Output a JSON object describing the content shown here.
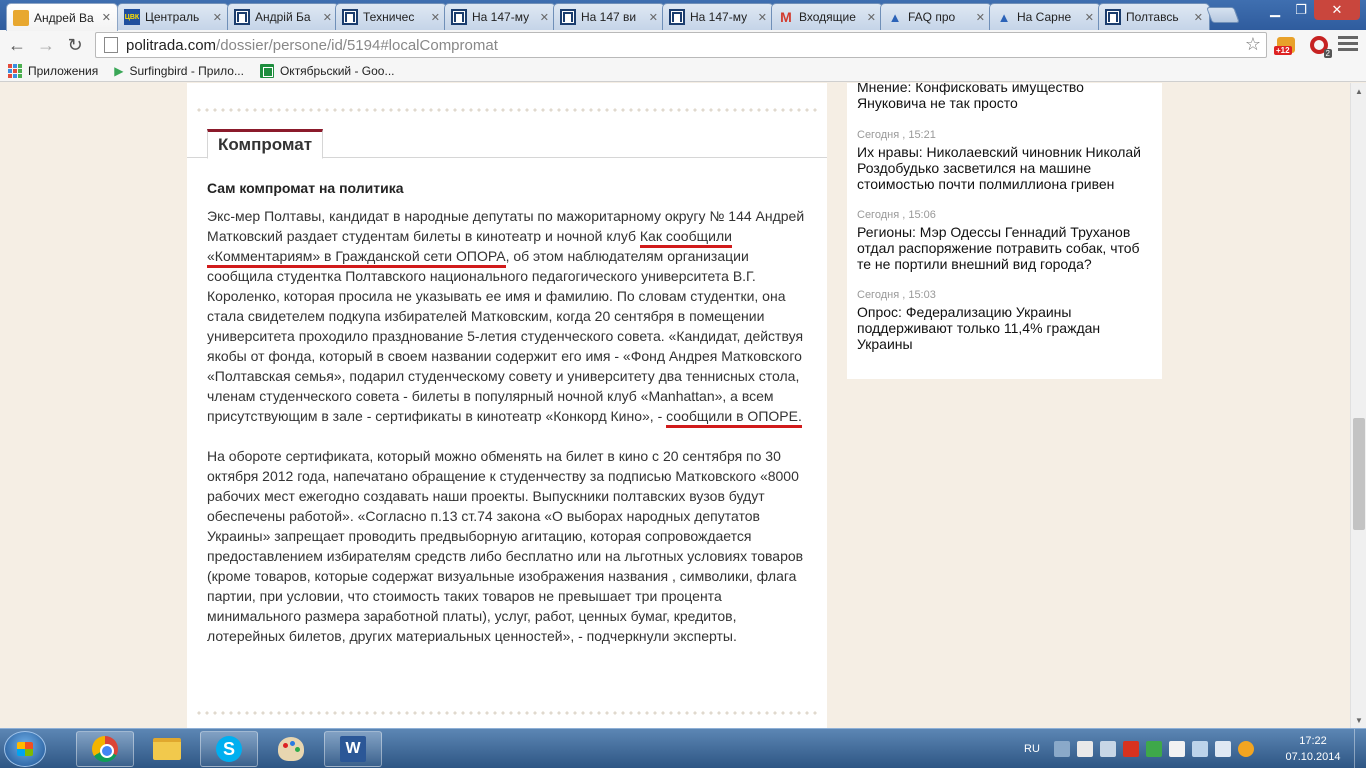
{
  "browser": {
    "tabs": [
      {
        "title": "Андрей Ва",
        "icon": "folder-icon",
        "active": true
      },
      {
        "title": "Централь",
        "icon": "cvk-icon",
        "active": false
      },
      {
        "title": "Андрій Ба",
        "icon": "politrada-icon",
        "active": false
      },
      {
        "title": "Техничес",
        "icon": "politrada-icon",
        "active": false
      },
      {
        "title": "На 147-му",
        "icon": "politrada-icon",
        "active": false
      },
      {
        "title": "На 147 ви",
        "icon": "politrada-icon",
        "active": false
      },
      {
        "title": "На 147-му",
        "icon": "politrada-icon",
        "active": false
      },
      {
        "title": "Входящие",
        "icon": "gmail-icon",
        "active": false
      },
      {
        "title": "FAQ про",
        "icon": "triangle-icon",
        "active": false
      },
      {
        "title": "На Сарне",
        "icon": "triangle-icon",
        "active": false
      },
      {
        "title": "Полтавсь",
        "icon": "politrada-icon",
        "active": false
      }
    ],
    "url_host": "politrada.com",
    "url_path": "/dossier/persone/id/5194#localCompromat",
    "extension_badge_1": "+12",
    "extension_badge_2": "2"
  },
  "bookmarks": [
    {
      "label": "Приложения",
      "icon": "apps-icon"
    },
    {
      "label": "Surfingbird - Прило...",
      "icon": "play-icon"
    },
    {
      "label": "Октябрьский - Goo...",
      "icon": "sheets-icon"
    }
  ],
  "section": {
    "tab_label": "Компромат",
    "article_title": "Сам компромат на политика",
    "p1": {
      "a": "Экс-мер Полтавы, кандидат в народные депутаты по мажоритарному округу № 144 Андрей Матковский раздает студентам билеты в кинотеатр и ночной клуб ",
      "u1": "Как сообщили «Комментариям» в Гражданской сети ОПОРА",
      "b": ", об этом наблюдателям организации сообщила студентка Полтавского национального педагогического университета В.Г. Короленко, которая просила не указывать ее имя и фамилию. По словам студентки, она стала свидетелем подкупа избирателей Матковским, когда 20 сентября в помещении университета проходило празднование 5-летия студенческого совета. «Кандидат, действуя якобы от фонда, который в своем названии содержит его имя - «Фонд Андрея Матковского «Полтавская семья», подарил студенческому совету и университету два теннисных стола, членам студенческого совета - билеты в популярный ночной клуб «Manhattan», а всем присутствующим в зале - сертификаты в кинотеатр «Конкорд Кино», - ",
      "u2": "сообщили в ОПОРЕ."
    },
    "p2": "На обороте сертификата, который можно обменять на билет в кино с 20 сентября по 30 октября 2012 года, напечатано обращение к студенчеству за подписью Матковского «8000 рабочих мест ежегодно создавать наши проекты. Выпускники полтавских вузов будут обеспечены работой». «Согласно п.13 ст.74 закона «О выборах народных депутатов Украины» запрещает проводить предвыборную агитацию, которая сопровождается предоставлением избирателям средств либо бесплатно или на льготных условиях товаров (кроме товаров, которые содержат визуальные изображения названия , символики, флага партии, при условии, что стоимость таких товаров не превышает три процента минимального размера заработной платы), услуг, работ, ценных бумаг, кредитов, лотерейных билетов, других материальных ценностей», - подчеркнули эксперты."
  },
  "sidebar": {
    "news": [
      {
        "time": "",
        "title": "Мнение: Конфисковать имущество Януковича не так просто"
      },
      {
        "time": "Сегодня , 15:21",
        "title": "Их нравы: Николаевский чиновник Николай Роздобудько засветился на машине стоимостью почти полмиллиона гривен"
      },
      {
        "time": "Сегодня , 15:06",
        "title": "Регионы: Мэр Одессы Геннадий Труханов отдал распоряжение потравить собак, чтоб те не портили внешний вид города?"
      },
      {
        "time": "Сегодня , 15:03",
        "title": "Опрос: Федерализацию Украины поддерживают только 11,4% граждан Украины"
      }
    ]
  },
  "taskbar": {
    "lang": "RU",
    "time": "17:22",
    "date": "07.10.2014"
  },
  "colors": {
    "accent": "#8b1a2b",
    "underline": "#d11b1b"
  }
}
